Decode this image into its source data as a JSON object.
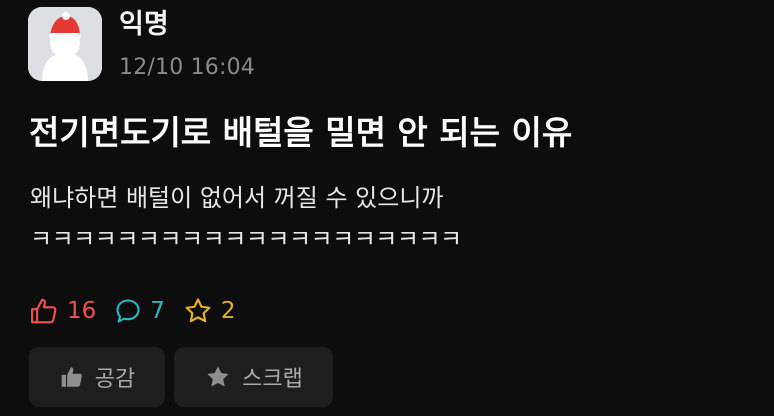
{
  "post": {
    "author": "익명",
    "timestamp": "12/10 16:04",
    "title": "전기면도기로 배털을 밀면 안 되는 이유",
    "body_lines": [
      "왜냐하면 배털이 없어서 꺼질 수 있으니까",
      "ㅋㅋㅋㅋㅋㅋㅋㅋㅋㅋㅋㅋㅋㅋㅋㅋㅋㅋㅋㅋ"
    ]
  },
  "stats": {
    "likes": "16",
    "comments": "7",
    "scraps": "2"
  },
  "actions": {
    "empathy_label": "공감",
    "scrap_label": "스크랩"
  },
  "icons": {
    "avatar": "anonymous-santa-avatar",
    "like": "thumbs-up-outline-icon",
    "comment": "speech-bubble-icon",
    "scrap": "star-outline-icon",
    "empathy_button": "thumbs-up-filled-icon",
    "scrap_button": "star-filled-icon"
  },
  "colors": {
    "background": "#0d0d0d",
    "like": "#ef5350",
    "comment": "#2bb6cc",
    "scrap": "#e8b02a",
    "button_bg": "#1e1e1e",
    "button_text": "#a9a9a9",
    "timestamp": "#8a8a8a"
  }
}
